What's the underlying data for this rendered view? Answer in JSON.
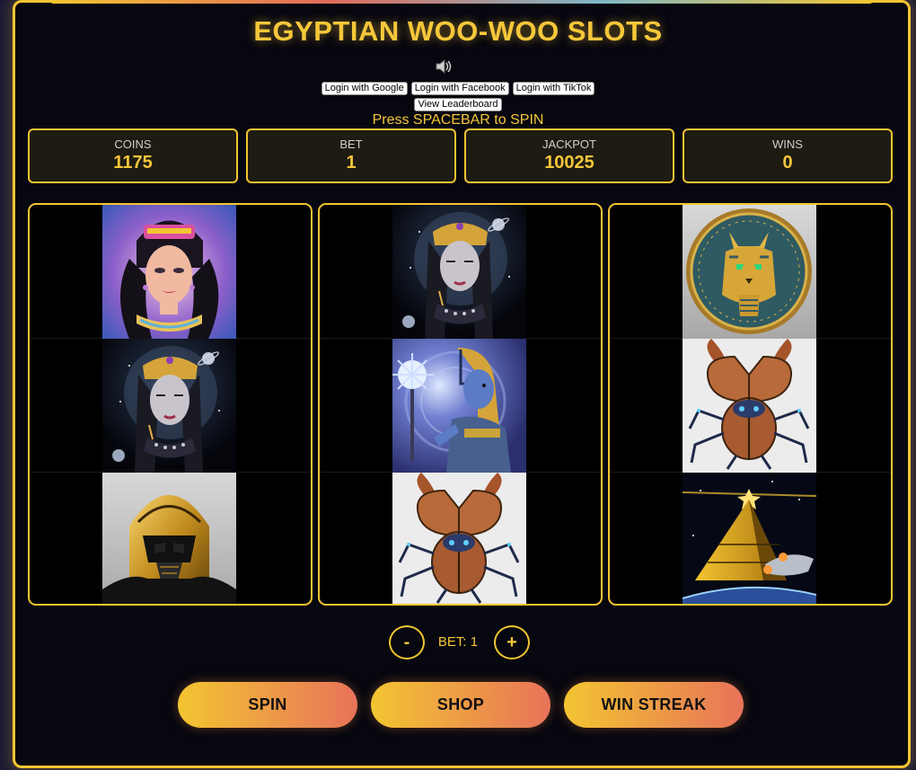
{
  "title": "EGYPTIAN WOO-WOO SLOTS",
  "sound_icon": "speaker-icon",
  "auth": {
    "google": "Login with Google",
    "facebook": "Login with Facebook",
    "tiktok": "Login with TikTok",
    "leaderboard": "View Leaderboard"
  },
  "hint": "Press SPACEBAR to SPIN",
  "stats": {
    "coins": {
      "label": "COINS",
      "value": "1175"
    },
    "bet": {
      "label": "BET",
      "value": "1"
    },
    "jackpot": {
      "label": "JACKPOT",
      "value": "10025"
    },
    "wins": {
      "label": "WINS",
      "value": "0"
    }
  },
  "reels": [
    [
      "queen-portrait",
      "cosmic-cleopatra",
      "golden-helmet-pharaoh"
    ],
    [
      "cosmic-cleopatra",
      "blue-sun-pharaoh",
      "robot-scarab"
    ],
    [
      "cat-pharaoh-coin",
      "robot-scarab",
      "pyramid-spaceship"
    ]
  ],
  "bet_control": {
    "minus": "-",
    "label": "BET: 1",
    "plus": "+"
  },
  "actions": {
    "spin": "SPIN",
    "shop": "SHOP",
    "win_streak": "WIN STREAK"
  },
  "colors": {
    "accent": "#f3c531",
    "background": "#07070f",
    "button_gradient_end": "#e8735a"
  }
}
